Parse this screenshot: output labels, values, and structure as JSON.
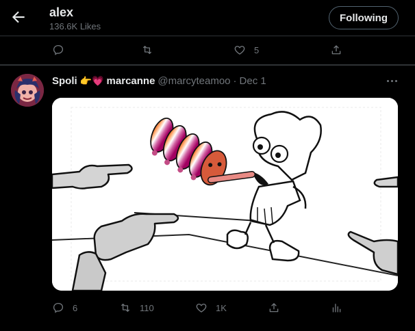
{
  "header": {
    "title": "alex",
    "subtitle": "136.6K Likes",
    "follow_label": "Following",
    "back_icon": "arrow-left-icon"
  },
  "prev_tweet_actions": {
    "reply_icon": "reply-icon",
    "retweet_icon": "retweet-icon",
    "like_icon": "heart-icon",
    "like_count": "5",
    "share_icon": "share-icon"
  },
  "tweet": {
    "display_name": "Spoli",
    "emoji": "👉💗",
    "display_name_2": "marcanne",
    "handle": "@marcyteamoo",
    "separator": "·",
    "date": "Dec 1",
    "more_icon": "more-icon",
    "media_description_icon": "image-icon",
    "actions": {
      "reply_count": "6",
      "retweet_count": "110",
      "like_count": "1K"
    }
  },
  "colors": {
    "background": "#000000",
    "text_primary": "#e7e9ea",
    "text_secondary": "#71767b",
    "divider": "#2f3336"
  }
}
